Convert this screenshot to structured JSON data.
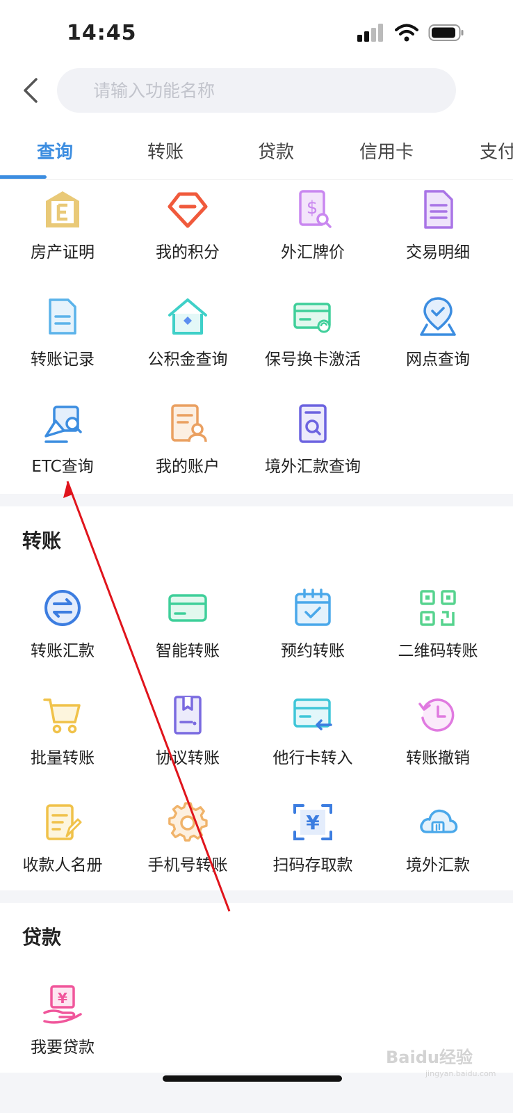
{
  "status_bar": {
    "time": "14:45"
  },
  "search": {
    "placeholder": "请输入功能名称"
  },
  "tabs": [
    {
      "label": "查询",
      "active": true
    },
    {
      "label": "转账",
      "active": false
    },
    {
      "label": "贷款",
      "active": false
    },
    {
      "label": "信用卡",
      "active": false
    },
    {
      "label": "支付",
      "active": false
    }
  ],
  "query_section": {
    "items": [
      {
        "label": "房产证明",
        "icon": "property-certificate-icon",
        "color": "#d8b96d"
      },
      {
        "label": "我的积分",
        "icon": "diamond-points-icon",
        "color": "#f05a3c"
      },
      {
        "label": "外汇牌价",
        "icon": "forex-price-icon",
        "color": "#c987f0"
      },
      {
        "label": "交易明细",
        "icon": "transaction-detail-icon",
        "color": "#a974e6"
      },
      {
        "label": "转账记录",
        "icon": "transfer-record-icon",
        "color": "#5bb3ea"
      },
      {
        "label": "公积金查询",
        "icon": "housing-fund-icon",
        "color": "#3fd0c8"
      },
      {
        "label": "保号换卡激活",
        "icon": "card-activation-icon",
        "color": "#3fcf9a"
      },
      {
        "label": "网点查询",
        "icon": "location-pin-icon",
        "color": "#3c8de0"
      },
      {
        "label": "ETC查询",
        "icon": "etc-query-icon",
        "color": "#3c8de0"
      },
      {
        "label": "我的账户",
        "icon": "my-account-icon",
        "color": "#eaa061"
      },
      {
        "label": "境外汇款查询",
        "icon": "overseas-remit-query-icon",
        "color": "#6c63e0"
      }
    ]
  },
  "transfer_section": {
    "title": "转账",
    "items": [
      {
        "label": "转账汇款",
        "icon": "transfer-remit-icon",
        "color": "#3c7de0"
      },
      {
        "label": "智能转账",
        "icon": "smart-transfer-icon",
        "color": "#3fcf9a"
      },
      {
        "label": "预约转账",
        "icon": "scheduled-transfer-icon",
        "color": "#4aa8ea"
      },
      {
        "label": "二维码转账",
        "icon": "qrcode-transfer-icon",
        "color": "#56d38e"
      },
      {
        "label": "批量转账",
        "icon": "cart-icon",
        "color": "#f0c24a"
      },
      {
        "label": "协议转账",
        "icon": "agreement-icon",
        "color": "#7a6ae0"
      },
      {
        "label": "他行卡转入",
        "icon": "other-bank-card-icon",
        "color": "#3fc6d8"
      },
      {
        "label": "转账撤销",
        "icon": "revoke-clock-icon",
        "color": "#e07ae0"
      },
      {
        "label": "收款人名册",
        "icon": "payee-list-icon",
        "color": "#f0c24a"
      },
      {
        "label": "手机号转账",
        "icon": "gear-icon",
        "color": "#f0b36a"
      },
      {
        "label": "扫码存取款",
        "icon": "scan-cash-icon",
        "color": "#3c7de0"
      },
      {
        "label": "境外汇款",
        "icon": "cloud-remit-icon",
        "color": "#4aa8ea"
      }
    ]
  },
  "loan_section": {
    "title": "贷款",
    "items": [
      {
        "label": "我要贷款",
        "icon": "loan-icon",
        "color": "#f0569b"
      }
    ]
  },
  "watermark": {
    "text": "Baidu经验",
    "sub": "jingyan.baidu.com"
  }
}
